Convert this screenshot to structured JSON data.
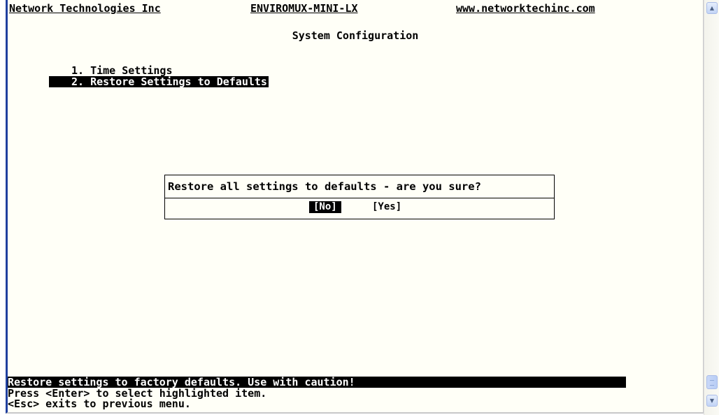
{
  "header": {
    "company": "Network Technologies Inc",
    "product": "ENVIROMUX-MINI-LX",
    "website": "www.networktechinc.com"
  },
  "title": "System Configuration",
  "menu": {
    "items": [
      {
        "label": "1. Time Settings",
        "selected": false
      },
      {
        "label": "2. Restore Settings to Defaults",
        "selected": true
      }
    ]
  },
  "dialog": {
    "message": "Restore all settings to defaults - are you sure?",
    "no_label": "[No]",
    "yes_label": "[Yes]",
    "selected": "No"
  },
  "status": {
    "description": "Restore settings to factory defaults. Use with caution!",
    "help_enter": "Press <Enter> to select highlighted item.",
    "help_esc": "<Esc> exits to previous menu."
  },
  "scrollbar": {
    "up_icon": "up-arrow-icon",
    "down_icon": "down-arrow-icon"
  }
}
